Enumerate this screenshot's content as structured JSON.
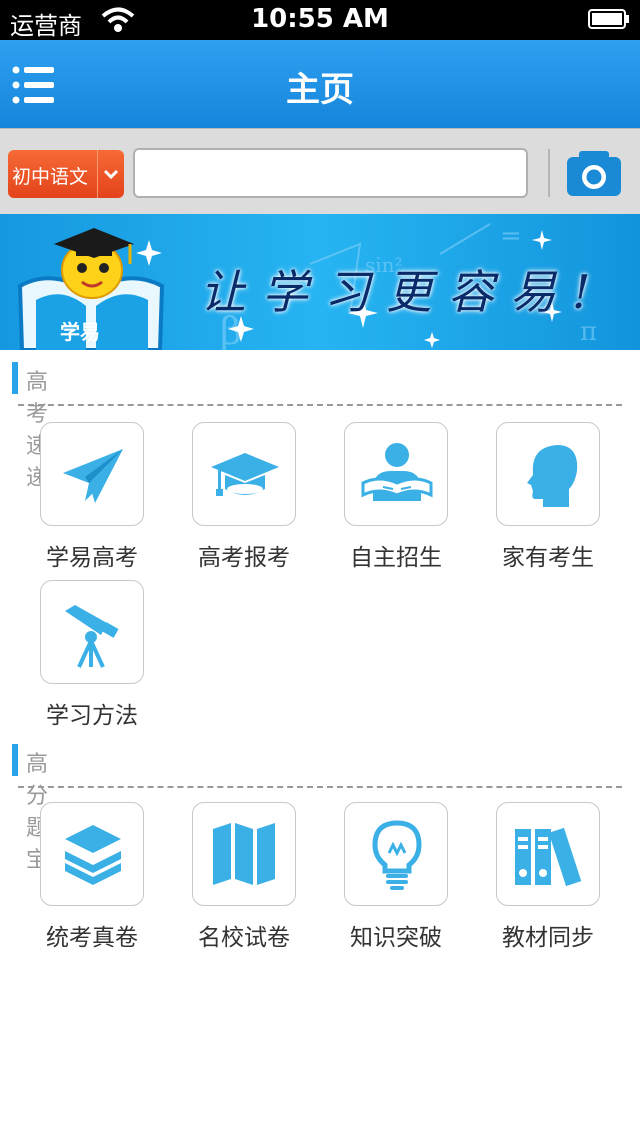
{
  "status_bar": {
    "carrier": "运营商",
    "time": "10:55 AM"
  },
  "nav": {
    "title": "主页",
    "menu_icon": "menu-icon"
  },
  "search": {
    "subject": "初中语文",
    "value": "",
    "placeholder": "",
    "camera_icon": "camera-icon"
  },
  "banner": {
    "slogan": "让学习更容易!",
    "logo_text": "学易"
  },
  "section1": {
    "title": "高考速递",
    "items": [
      {
        "label": "学易高考",
        "icon": "paper-plane-icon"
      },
      {
        "label": "高考报考",
        "icon": "graduation-cap-icon"
      },
      {
        "label": "自主招生",
        "icon": "reader-icon"
      },
      {
        "label": "家有考生",
        "icon": "head-icon"
      },
      {
        "label": "学习方法",
        "icon": "telescope-icon"
      }
    ]
  },
  "section2": {
    "title": "高分题宝",
    "items": [
      {
        "label": "统考真卷",
        "icon": "layers-icon"
      },
      {
        "label": "名校试卷",
        "icon": "map-icon"
      },
      {
        "label": "知识突破",
        "icon": "lightbulb-icon"
      },
      {
        "label": "教材同步",
        "icon": "binders-icon"
      }
    ]
  },
  "colors": {
    "accent": "#29a4e8",
    "nav": "#1e90e6",
    "subject": "#ee5325",
    "icon": "#3ab0e6"
  }
}
